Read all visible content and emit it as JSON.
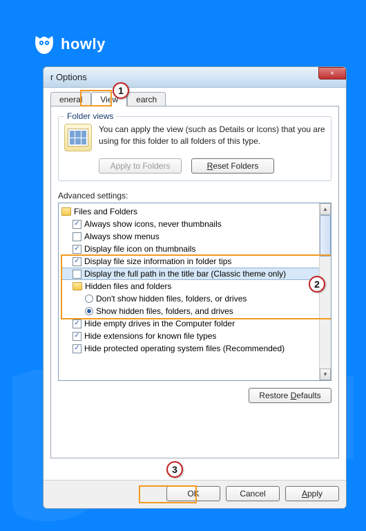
{
  "brand": {
    "name": "howly"
  },
  "window": {
    "title": "r Options",
    "close": "×"
  },
  "tabs": {
    "general": "eneral",
    "view": "View",
    "search": "earch"
  },
  "folder_views": {
    "group_label": "Folder views",
    "description": "You can apply the view (such as Details or Icons) that you are using for this folder to all folders of this type.",
    "apply_btn": "Apply to Folders",
    "reset_btn": "Reset Folders",
    "reset_mn": "R"
  },
  "advanced": {
    "label": "Advanced settings:",
    "restore_btn": "Restore Defaults",
    "restore_mn": "D",
    "root": "Files and Folders",
    "items": [
      {
        "type": "check",
        "checked": true,
        "label": "Always show icons, never thumbnails"
      },
      {
        "type": "check",
        "checked": false,
        "label": "Always show menus"
      },
      {
        "type": "check",
        "checked": true,
        "label": "Display file icon on thumbnails"
      },
      {
        "type": "check",
        "checked": true,
        "label": "Display file size information in folder tips"
      },
      {
        "type": "check",
        "checked": false,
        "label": "Display the full path in the title bar (Classic theme only)",
        "selected": true
      },
      {
        "type": "folder",
        "label": "Hidden files and folders"
      },
      {
        "type": "radio",
        "checked": false,
        "label": "Don't show hidden files, folders, or drives"
      },
      {
        "type": "radio",
        "checked": true,
        "label": "Show hidden files, folders, and drives"
      },
      {
        "type": "check",
        "checked": true,
        "label": "Hide empty drives in the Computer folder"
      },
      {
        "type": "check",
        "checked": true,
        "label": "Hide extensions for known file types"
      },
      {
        "type": "check",
        "checked": true,
        "label": "Hide protected operating system files (Recommended)"
      }
    ]
  },
  "buttons": {
    "ok": "OK",
    "cancel": "Cancel",
    "apply": "Apply",
    "apply_mn": "A"
  },
  "callouts": {
    "1": "1",
    "2": "2",
    "3": "3"
  }
}
